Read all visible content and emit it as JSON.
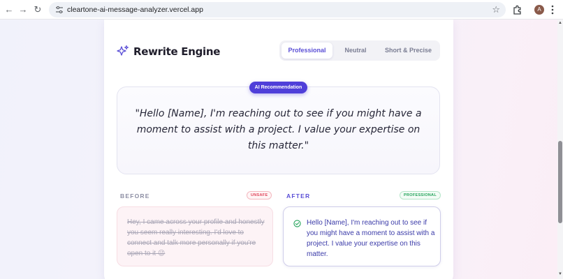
{
  "browser": {
    "url": "cleartone-ai-message-analyzer.vercel.app",
    "avatar_letter": "A"
  },
  "app": {
    "title": "Rewrite Engine",
    "tabs": [
      {
        "label": "Professional",
        "active": true
      },
      {
        "label": "Neutral",
        "active": false
      },
      {
        "label": "Short & Precise",
        "active": false
      }
    ],
    "recommendation": {
      "badge": "AI Recommendation",
      "text": "\"Hello [Name], I'm reaching out to see if you might have a moment to assist with a project. I value your expertise on this matter.\""
    },
    "before": {
      "label": "BEFORE",
      "status": "UNSAFE",
      "text": "Hey, I came across your profile and honestly you seem really interesting. I'd love to connect and talk more personally if you're open to it 😉"
    },
    "after": {
      "label": "AFTER",
      "status": "PROFESSIONAL",
      "text": "Hello [Name], I'm reaching out to see if you might have a moment to assist with a project. I value your expertise on this matter."
    }
  },
  "colors": {
    "accent": "#4f3fd9",
    "before_label": "#8c8ea3",
    "after_label": "#5b4fd6",
    "unsafe": "#e0455a",
    "professional": "#23a35a"
  }
}
